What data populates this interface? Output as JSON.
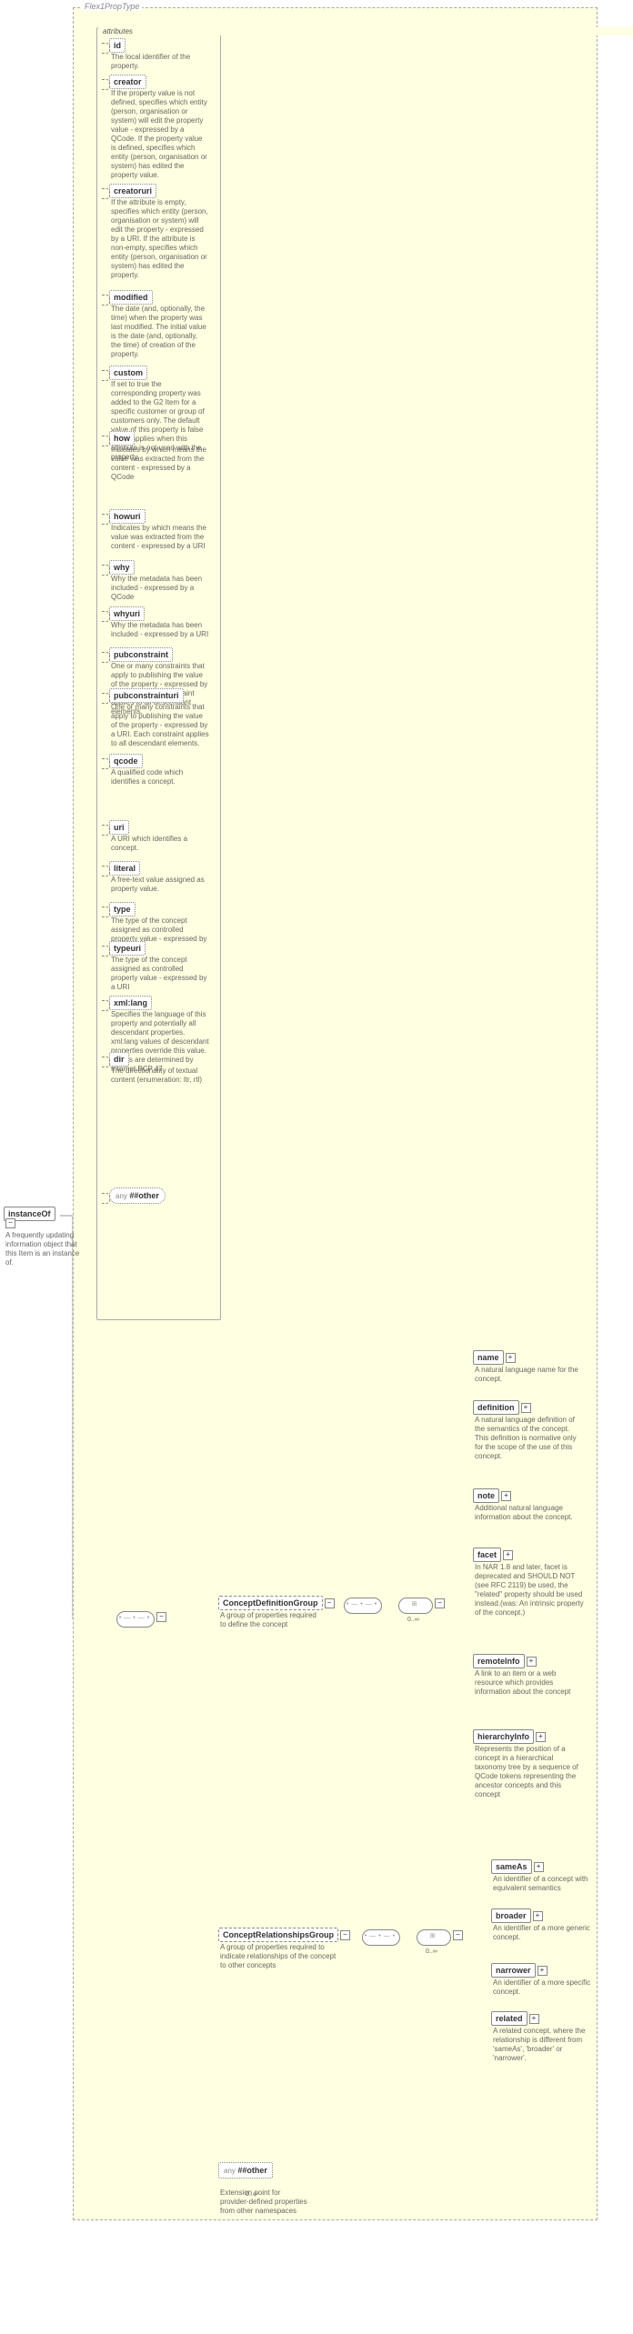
{
  "root": {
    "name": "instanceOf",
    "doc": "A frequently updating information object that this Item is an instance of."
  },
  "type": "Flex1PropType",
  "attrs_h": "attributes",
  "attrs": [
    {
      "name": "id",
      "doc": "The local identifier of the property."
    },
    {
      "name": "creator",
      "doc": "If the property value is not defined, specifies which entity (person, organisation or system) will edit the property value - expressed by a QCode. If the property value is defined, specifies which entity (person, organisation or system) has edited the property value."
    },
    {
      "name": "creatoruri",
      "doc": "If the attribute is empty, specifies which entity (person, organisation or system) will edit the property - expressed by a URI. If the attribute is non-empty, specifies which entity (person, organisation or system) has edited the property."
    },
    {
      "name": "modified",
      "doc": "The date (and, optionally, the time) when the property was last modified. The initial value is the date (and, optionally, the time) of creation of the property."
    },
    {
      "name": "custom",
      "doc": "If set to true the corresponding property was added to the G2 Item for a specific customer or group of customers only. The default value of this property is false which applies when this attribute is not used with the property."
    },
    {
      "name": "how",
      "doc": "Indicates by which means the value was extracted from the content - expressed by a QCode"
    },
    {
      "name": "howuri",
      "doc": "Indicates by which means the value was extracted from the content - expressed by a URI"
    },
    {
      "name": "why",
      "doc": "Why the metadata has been included - expressed by a QCode"
    },
    {
      "name": "whyuri",
      "doc": "Why the metadata has been included - expressed by a URI"
    },
    {
      "name": "pubconstraint",
      "doc": "One or many constraints that apply to publishing the value of the property - expressed by a QCode. Each constraint applies to all descendant elements."
    },
    {
      "name": "pubconstrainturi",
      "doc": "One or many constraints that apply to publishing the value of the property - expressed by a URI. Each constraint applies to all descendant elements."
    },
    {
      "name": "qcode",
      "doc": "A qualified code which identifies a concept."
    },
    {
      "name": "uri",
      "doc": "A URI which identifies a concept."
    },
    {
      "name": "literal",
      "doc": "A free-text value assigned as property value."
    },
    {
      "name": "type",
      "doc": "The type of the concept assigned as controlled property value - expressed by a QCode"
    },
    {
      "name": "typeuri",
      "doc": "The type of the concept assigned as controlled property value - expressed by a URI"
    },
    {
      "name": "xml:lang",
      "doc": "Specifies the language of this property and potentially all descendant properties. xml:lang values of descendant properties override this value. Values are determined by Internet BCP 47."
    },
    {
      "name": "dir",
      "doc": "The directionality of textual content (enumeration: ltr, rtl)"
    }
  ],
  "attrAny": "##other",
  "g1": {
    "name": "ConceptDefinitionGroup",
    "doc": "A group of properties required to define the concept",
    "card": "0..∞",
    "items": [
      {
        "name": "name",
        "doc": "A natural language name for the concept."
      },
      {
        "name": "definition",
        "doc": "A natural language definition of the semantics of the concept. This definition is normative only for the scope of the use of this concept."
      },
      {
        "name": "note",
        "doc": "Additional natural language information about the concept."
      },
      {
        "name": "facet",
        "doc": "In NAR 1.8 and later, facet is deprecated and SHOULD NOT (see RFC 2119) be used, the \"related\" property should be used instead.(was: An intrinsic property of the concept.)"
      },
      {
        "name": "remoteInfo",
        "doc": "A link to an item or a web resource which provides information about the concept"
      },
      {
        "name": "hierarchyInfo",
        "doc": "Represents the position of a concept in a hierarchical taxonomy tree by a sequence of QCode tokens representing the ancestor concepts and this concept"
      }
    ]
  },
  "g2": {
    "name": "ConceptRelationshipsGroup",
    "doc": "A group of properties required to indicate relationships of the concept to other concepts",
    "card": "0..∞",
    "items": [
      {
        "name": "sameAs",
        "doc": "An identifier of a concept with equivalent semantics"
      },
      {
        "name": "broader",
        "doc": "An identifier of a more generic concept."
      },
      {
        "name": "narrower",
        "doc": "An identifier of a more specific concept."
      },
      {
        "name": "related",
        "doc": "A related concept, where the relationship is different from 'sameAs', 'broader' or 'narrower'."
      }
    ]
  },
  "wild": {
    "label": "##other",
    "card": "0..∞",
    "doc": "Extension point for provider-defined properties from other namespaces"
  },
  "anyLabel": "any",
  "chart_data": {
    "type": "schema-tree",
    "note": "XSD documentation diagram"
  }
}
